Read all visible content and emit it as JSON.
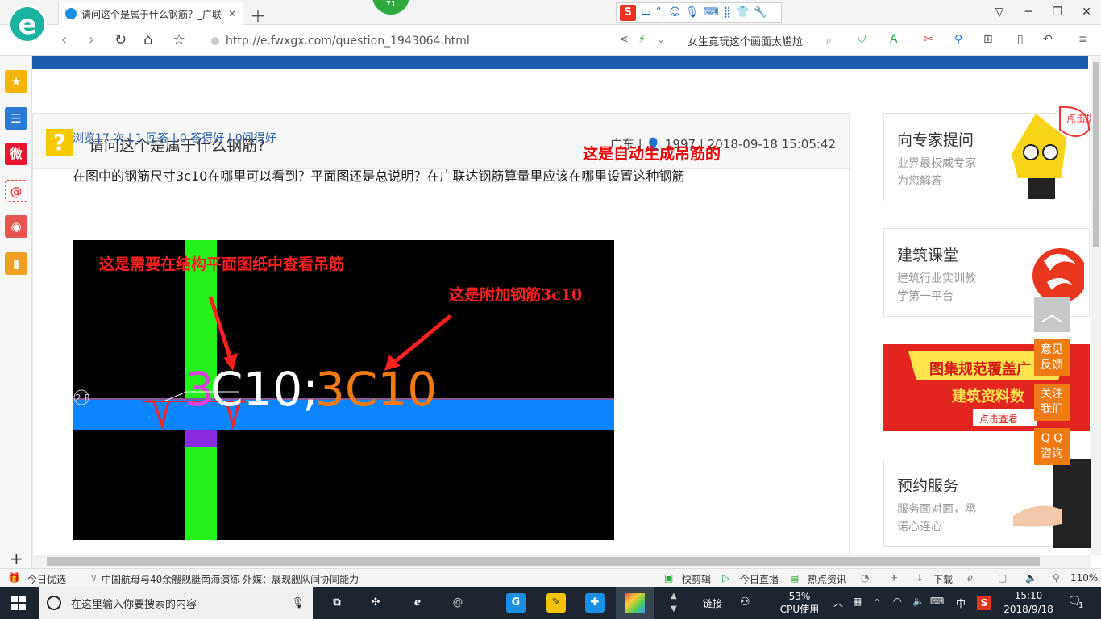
{
  "browser": {
    "tab_title": "请问这个是属于什么钢筋？_广联",
    "tab_close": "✕",
    "new_tab": "＋",
    "badge": "71",
    "ime": {
      "s": "S",
      "lang": "中",
      "punct": "°,"
    },
    "window_controls": {
      "restore_small": "▽",
      "minimize": "─",
      "maximize": "❐",
      "close": "✕"
    },
    "url": "http://e.fwxgx.com/question_1943064.html",
    "search_text": "女生竟玩这个画面太尴尬",
    "zoom": "110%"
  },
  "sidebar": {
    "items": [
      {
        "label": "★",
        "color": "#f5b400"
      },
      {
        "label": "☰",
        "color": "#2a7ad6"
      },
      {
        "label": "微",
        "color": "#e6162d"
      },
      {
        "label": "@",
        "color": "#e94a3c"
      },
      {
        "label": "◉",
        "color": "#e8554e"
      },
      {
        "label": "▮",
        "color": "#f0a020"
      }
    ],
    "add": "+"
  },
  "question": {
    "title": "请问这个是属于什么钢筋?",
    "location": "广东",
    "user": "1997",
    "datetime": "2018-09-18 15:05:42",
    "stats": "浏览17 次 | 1 回答 | 0 答得好 | 0问得好",
    "body": "在图中的钢筋尺寸3c10在哪里可以看到？平面图还是总说明？在广联达钢筋算量里应该在哪里设置这种钢筋",
    "annotation": "这是自动生成吊筋的"
  },
  "cad_image": {
    "label_top": "这是需要在结构平面图纸中查看吊筋",
    "label_right": "这是附加钢筋3c10",
    "big_text": "3C10;3C10",
    "axis": "2 E"
  },
  "right_cards": [
    {
      "title": "向专家提问",
      "sub1": "业界最权威专家",
      "sub2": "为您解答",
      "bubble": "点击提问"
    },
    {
      "title": "建筑课堂",
      "sub1": "建筑行业实训教",
      "sub2": "学第一平台"
    },
    {
      "banner1": "图集规范覆盖广",
      "banner2": "建筑资料数",
      "banner3": "点击查看"
    },
    {
      "title": "预约服务",
      "sub1": "服务面对面，承",
      "sub2": "诺心连心"
    }
  ],
  "float_buttons": {
    "top": "︿",
    "feedback": [
      "意见",
      "反馈"
    ],
    "follow": [
      "关注",
      "我们"
    ],
    "qq": [
      "Q Q",
      "咨询"
    ]
  },
  "statusbar": {
    "today": "今日优选",
    "news": "中国航母与40余艘舰艇南海演练 外媒：展现舰队间协同能力",
    "kuaijian": "快剪辑",
    "zhibo": "今日直播",
    "redian": "热点资讯",
    "download": "下载"
  },
  "taskbar": {
    "search_placeholder": "在这里输入你要搜索的内容",
    "link": "链接",
    "cpu_value": "53%",
    "cpu_label": "CPU使用",
    "ime_lang": "中",
    "time": "15:10",
    "date": "2018/9/18",
    "notif": "1"
  }
}
